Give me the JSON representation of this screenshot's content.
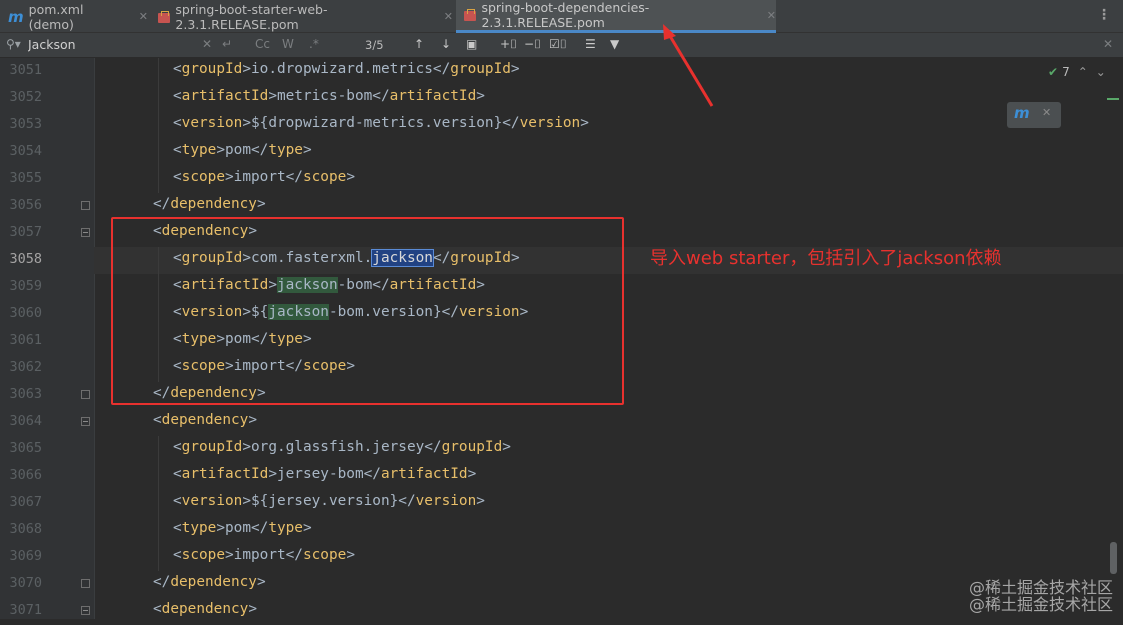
{
  "tabs": [
    {
      "label": "pom.xml (demo)",
      "icon": "maven-m-icon",
      "active": false
    },
    {
      "label": "spring-boot-starter-web-2.3.1.RELEASE.pom",
      "icon": "pom-file-icon",
      "active": false
    },
    {
      "label": "spring-boot-dependencies-2.3.1.RELEASE.pom",
      "icon": "pom-file-icon",
      "active": true
    }
  ],
  "find": {
    "query": "Jackson",
    "match_count": "3/5",
    "options": {
      "match_case": "Cc",
      "words": "W",
      "regex": ".*"
    }
  },
  "inspection": {
    "count": "7"
  },
  "lines": [
    {
      "num": "3051",
      "text": "<groupId>io.dropwizard.metrics</groupId>"
    },
    {
      "num": "3052",
      "text": "<artifactId>metrics-bom</artifactId>"
    },
    {
      "num": "3053",
      "text": "<version>${dropwizard-metrics.version}</version>"
    },
    {
      "num": "3054",
      "text": "<type>pom</type>"
    },
    {
      "num": "3055",
      "text": "<scope>import</scope>"
    },
    {
      "num": "3056",
      "text": "</dependency>"
    },
    {
      "num": "3057",
      "text": "<dependency>"
    },
    {
      "num": "3058",
      "text": "<groupId>com.fasterxml.jackson</groupId>"
    },
    {
      "num": "3059",
      "text": "<artifactId>jackson-bom</artifactId>"
    },
    {
      "num": "3060",
      "text": "<version>${jackson-bom.version}</version>"
    },
    {
      "num": "3061",
      "text": "<type>pom</type>"
    },
    {
      "num": "3062",
      "text": "<scope>import</scope>"
    },
    {
      "num": "3063",
      "text": "</dependency>"
    },
    {
      "num": "3064",
      "text": "<dependency>"
    },
    {
      "num": "3065",
      "text": "<groupId>org.glassfish.jersey</groupId>"
    },
    {
      "num": "3066",
      "text": "<artifactId>jersey-bom</artifactId>"
    },
    {
      "num": "3067",
      "text": "<version>${jersey.version}</version>"
    },
    {
      "num": "3068",
      "text": "<type>pom</type>"
    },
    {
      "num": "3069",
      "text": "<scope>import</scope>"
    },
    {
      "num": "3070",
      "text": "</dependency>"
    },
    {
      "num": "3071",
      "text": "<dependency>"
    }
  ],
  "annotation": "导入web starter，包括引入了jackson依赖",
  "watermark": [
    "@稀土掘金技术社区",
    "@稀土掘金技术社区"
  ],
  "colors": {
    "tag": "#e8bf6a",
    "text": "#a9b7c6",
    "annotation": "#e8312e",
    "match": "#32593d",
    "current_match": "#214283"
  }
}
